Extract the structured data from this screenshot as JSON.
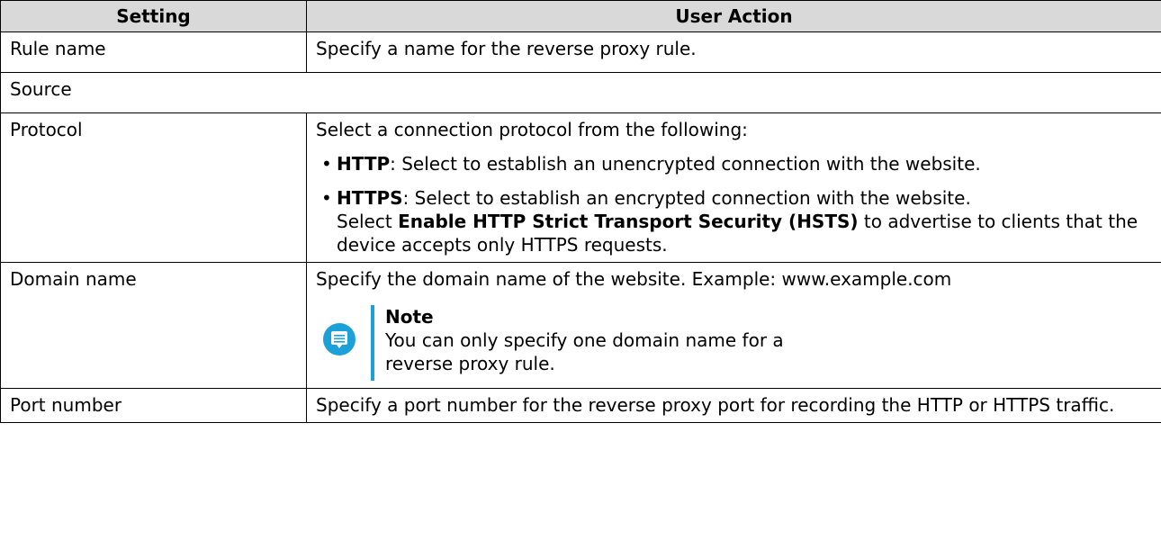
{
  "table": {
    "headers": {
      "setting": "Setting",
      "action": "User Action"
    },
    "rows": {
      "rule_name": {
        "setting": "Rule name",
        "action": "Specify a name for the reverse proxy rule."
      },
      "source": {
        "label": "Source"
      },
      "protocol": {
        "setting": "Protocol",
        "intro": "Select a connection protocol from the following:",
        "bullet_char": "•",
        "http": {
          "term": "HTTP",
          "text": ": Select to establish an unencrypted connection with the website."
        },
        "https": {
          "term": "HTTPS",
          "text": ": Select to establish an encrypted connection with the website.",
          "select_prefix": "Select ",
          "select_option": "Enable HTTP Strict Transport Security (HSTS)",
          "select_suffix": " to advertise to clients that the device accepts only HTTPS requests."
        }
      },
      "domain_name": {
        "setting": "Domain name",
        "action": "Specify the domain name of the website. Example: www.example.com",
        "note": {
          "icon": "note-icon",
          "title": "Note",
          "text": "You can only specify one domain name for a reverse proxy rule."
        }
      },
      "port_number": {
        "setting": "Port number",
        "action": "Specify a port number for the reverse proxy port for recording the HTTP or HTTPS traffic."
      }
    }
  },
  "colors": {
    "header_bg": "#d9d9d9",
    "note_accent": "#1ba1d8"
  }
}
